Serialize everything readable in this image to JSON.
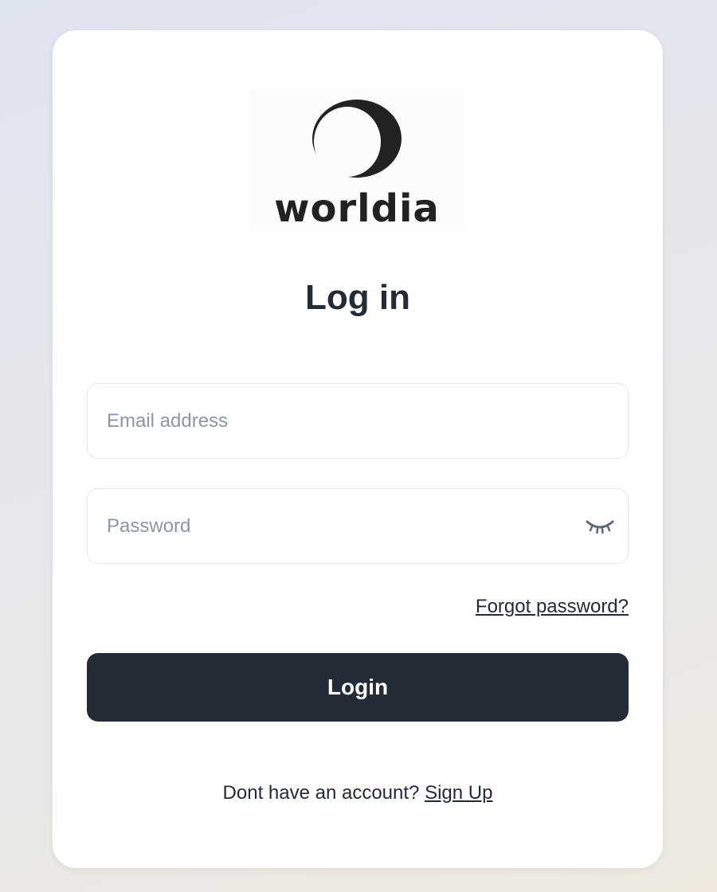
{
  "logo": {
    "wordmark": "worldia",
    "icon": "ring-logo-icon"
  },
  "login": {
    "title": "Log in",
    "email": {
      "value": "",
      "placeholder": "Email address"
    },
    "password": {
      "value": "",
      "placeholder": "Password",
      "toggle_icon": "eye-closed-icon"
    },
    "forgot_password": "Forgot password?",
    "submit_label": "Login",
    "signup_prompt": "Dont have an account?",
    "signup_link": "Sign Up"
  },
  "colors": {
    "primary": "#232b36",
    "placeholder": "#8d97a3",
    "border": "#e3e6ea",
    "card": "#ffffff"
  }
}
